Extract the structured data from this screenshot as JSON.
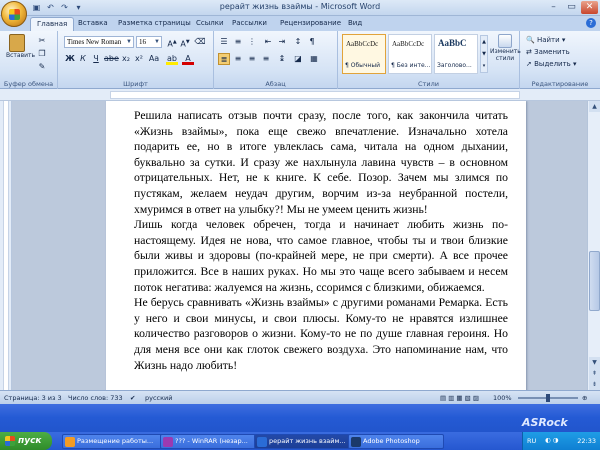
{
  "window": {
    "title": "рерайт жизнь взаймы - Microsoft Word"
  },
  "tabs": [
    "Главная",
    "Вставка",
    "Разметка страницы",
    "Ссылки",
    "Рассылки",
    "Рецензирование",
    "Вид"
  ],
  "ribbon": {
    "clipboard_label": "Буфер обмена",
    "paste_label": "Вставить",
    "font_label": "Шрифт",
    "font_name": "Times New Roman",
    "font_size": "16",
    "bold": "Ж",
    "italic": "К",
    "underline": "Ч",
    "paragraph_label": "Абзац",
    "styles_label": "Стили",
    "styles": [
      {
        "sample": "AaBbCcDc",
        "name": "¶ Обычный"
      },
      {
        "sample": "AaBbCcDc",
        "name": "¶ Без инте..."
      },
      {
        "sample": "AaBbC",
        "name": "Заголово..."
      }
    ],
    "change_styles": "Изменить стили",
    "editing_label": "Редактирование",
    "find": "Найти",
    "replace": "Заменить",
    "select": "Выделить"
  },
  "document": {
    "paragraphs": [
      "Решила написать отзыв почти сразу, после того, как закончила читать «Жизнь взаймы», пока еще свежо впечатление. Изначально хотела подарить ее, но в итоге увлеклась сама, читала на одном дыхании, буквально за сутки. И сразу же нахлынула лавина чувств – в основном отрицательных. Нет, не к книге. К себе. Позор. Зачем мы злимся по пустякам, желаем неудач другим, ворчим из-за неубранной постели, хмуримся в ответ на улыбку?! Мы не умеем ценить жизнь!",
      "Лишь когда человек обречен, тогда и начинает любить жизнь по-настоящему. Идея не нова, что самое главное, чтобы ты и твои близкие были живы и здоровы (по-крайней мере, не при смерти). А все прочее приложится. Все в наших руках. Но мы это чаще всего забываем и несем поток негатива: жалуемся на жизнь, ссоримся с близкими, обижаемся.",
      "Не берусь сравнивать «Жизнь взаймы» с другими романами Ремарка. Есть у него и свои минусы, и свои плюсы. Кому-то не нравятся излишнее количество разговоров о жизни. Кому-то не по душе главная героиня. Но для меня все они как глоток свежего воздуха. Это напоминание нам, что Жизнь надо любить!"
    ]
  },
  "status": {
    "page": "Страница: 3 из 3",
    "words": "Число слов: 733",
    "language": "русский",
    "zoom": "100%"
  },
  "taskbar": {
    "start": "пуск",
    "tasks": [
      "Размещение работы...",
      "??? - WinRAR (незар...",
      "рерайт жизнь взайм...",
      "Adobe Photoshop"
    ],
    "lang": "RU",
    "clock": "22:33",
    "brand": "ASRock"
  },
  "colors": {
    "ribbon": "#d5e3f5",
    "taskbar": "#245ad4",
    "start": "#3ea13c"
  }
}
